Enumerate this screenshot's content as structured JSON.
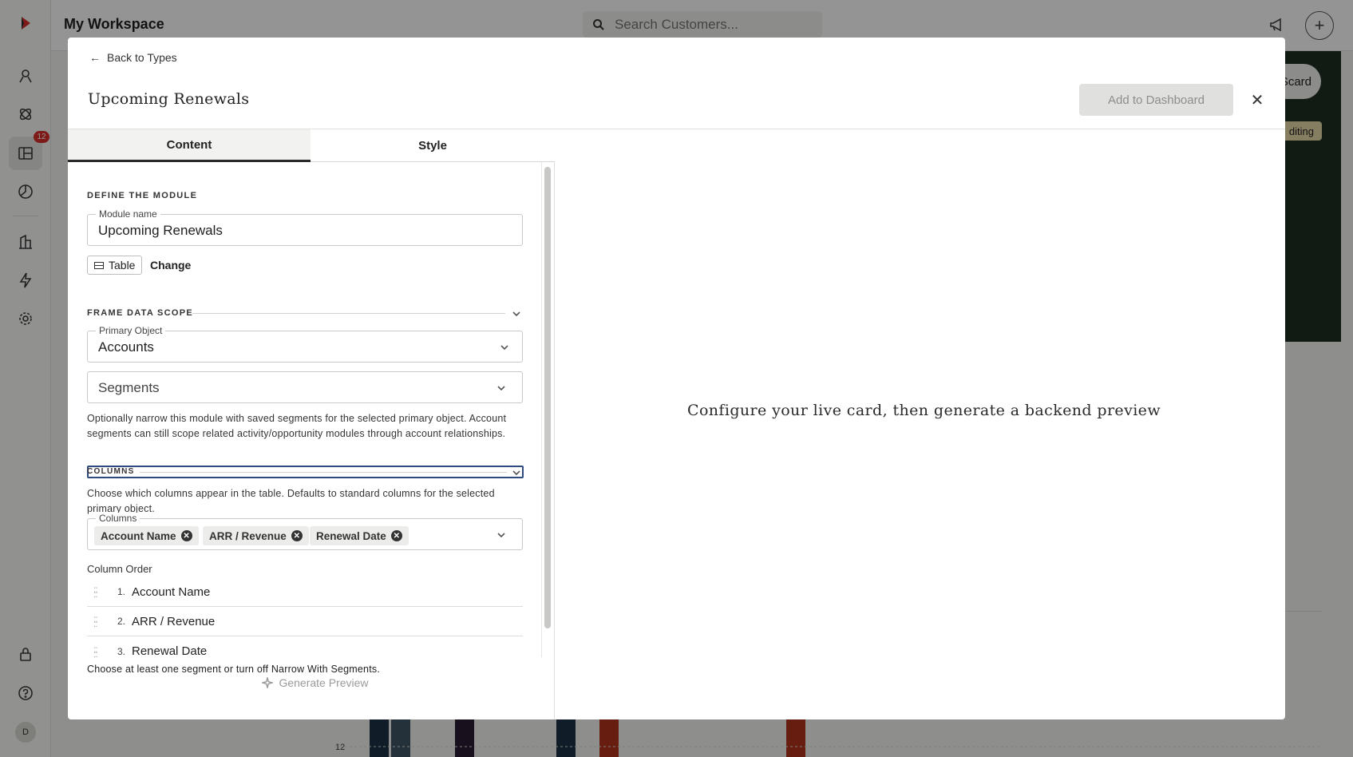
{
  "app": {
    "workspace_title": "My Workspace",
    "search_placeholder": "Search Customers...",
    "nav_badge": "12",
    "avatar_initial": "D",
    "card_button_label": "Scard",
    "card_tag_label": "diting"
  },
  "modal": {
    "back_label": "Back to Types",
    "title": "Upcoming Renewals",
    "add_button": "Add to Dashboard",
    "tabs": [
      {
        "label": "Content",
        "active": true
      },
      {
        "label": "Style",
        "active": false
      }
    ],
    "define_section": "Define the module",
    "module_name_label": "Module name",
    "module_name_value": "Upcoming Renewals",
    "type_label": "Table",
    "change_label": "Change",
    "scope_section": "Frame data scope",
    "primary_object_label": "Primary Object",
    "primary_object_value": "Accounts",
    "segments_placeholder": "Segments",
    "segments_help": "Optionally narrow this module with saved segments for the selected primary object. Account segments can still scope related activity/opportunity modules through account relationships.",
    "columns_section": "Columns",
    "columns_help": "Choose which columns appear in the table. Defaults to standard columns for the selected primary object.",
    "columns_field_label": "Columns",
    "selected_columns": [
      "Account Name",
      "ARR / Revenue",
      "Renewal Date"
    ],
    "column_order_label": "Column Order",
    "column_order": [
      {
        "num": "1.",
        "name": "Account Name"
      },
      {
        "num": "2.",
        "name": "ARR / Revenue"
      },
      {
        "num": "3.",
        "name": "Renewal Date"
      }
    ],
    "validation_message": "Choose at least one segment or turn off Narrow With Segments.",
    "generate_button": "Generate Preview",
    "preview_message": "Configure your live card, then generate a backend preview"
  },
  "background_chart": {
    "y_tick_label": "12"
  },
  "colors": {
    "scrim": "#000000",
    "dark_card": "#1e2d22",
    "bar_navy": "#1d3346",
    "bar_slate": "#3f5566",
    "bar_purple": "#2a1d33",
    "bar_red": "#b2321c",
    "focus_outline": "#2f4a7e"
  }
}
